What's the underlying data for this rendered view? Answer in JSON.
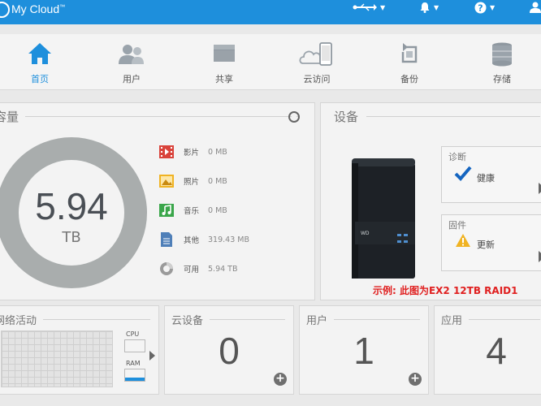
{
  "app": {
    "brand": "My Cloud",
    "tm": "™"
  },
  "topbar_icons": [
    "usb-icon",
    "bell-icon",
    "help-icon",
    "user-icon"
  ],
  "nav": [
    {
      "label": "首页",
      "icon": "home-icon",
      "active": true
    },
    {
      "label": "用户",
      "icon": "users-icon",
      "active": false
    },
    {
      "label": "共享",
      "icon": "folder-icon",
      "active": false
    },
    {
      "label": "云访问",
      "icon": "cloud-access-icon",
      "active": false
    },
    {
      "label": "备份",
      "icon": "backup-icon",
      "active": false
    },
    {
      "label": "存储",
      "icon": "storage-icon",
      "active": false
    }
  ],
  "capacity": {
    "title": "容量",
    "free_value": "5.94",
    "free_unit": "TB",
    "legend": [
      {
        "name": "影片",
        "value": "0 MB",
        "icon": "video-icon",
        "color": "#d9433b"
      },
      {
        "name": "照片",
        "value": "0 MB",
        "icon": "photo-icon",
        "color": "#f0b323"
      },
      {
        "name": "音乐",
        "value": "0 MB",
        "icon": "music-icon",
        "color": "#3aa64a"
      },
      {
        "name": "其他",
        "value": "319.43 MB",
        "icon": "document-icon",
        "color": "#4f7fb8"
      },
      {
        "name": "可用",
        "value": "5.94 TB",
        "icon": "pie-icon",
        "color": "#9a9a9a"
      }
    ]
  },
  "device": {
    "title": "设备",
    "diagnostics": {
      "title": "诊断",
      "status": "健康",
      "icon": "checkmark-icon"
    },
    "firmware": {
      "title": "固件",
      "status": "更新",
      "icon": "warning-icon"
    },
    "caption": "示例: 此图为EX2 12TB RAID1"
  },
  "network": {
    "title": "网络活动",
    "cpu_label": "CPU",
    "ram_label": "RAM"
  },
  "cloud_devices": {
    "title": "云设备",
    "count": "0"
  },
  "users": {
    "title": "用户",
    "count": "1"
  },
  "apps": {
    "title": "应用",
    "count": "4"
  },
  "colors": {
    "accent": "#1e8fdc",
    "caption": "#e02020",
    "donut": "#a9adad"
  }
}
